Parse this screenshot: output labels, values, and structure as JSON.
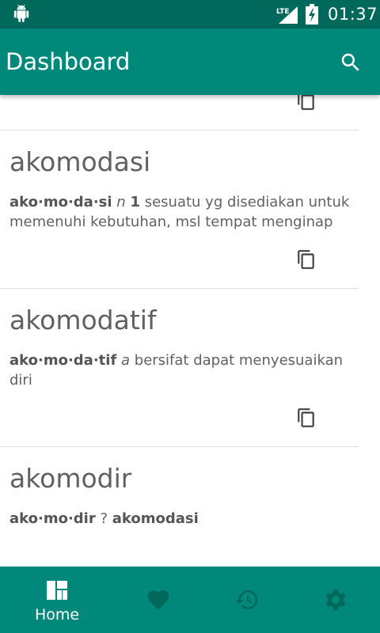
{
  "status_bar": {
    "time": "01:37",
    "network": "LTE"
  },
  "app_bar": {
    "title": "Dashboard",
    "search_icon": "search-icon"
  },
  "entries": [
    {
      "word": "",
      "syllables": "",
      "pos": "",
      "sense": "",
      "text": ""
    },
    {
      "word": "akomodasi",
      "syllables": "ako·mo·da·si",
      "pos": "n",
      "sense": "1",
      "text": "sesuatu yg disediakan untuk memenuhi kebutuhan, msl tempat menginap"
    },
    {
      "word": "akomodatif",
      "syllables": "ako·mo·da·tif",
      "pos": "a",
      "sense": "",
      "text": "bersifat dapat menyesuaikan diri"
    },
    {
      "word": "akomodir",
      "syllables": "ako·mo·dir",
      "pos": "",
      "sense": "",
      "text": "?",
      "ref": "akomodasi"
    }
  ],
  "bottom_nav": {
    "home_label": "Home",
    "items": [
      "dashboard-icon",
      "heart-icon",
      "history-icon",
      "gear-icon"
    ]
  },
  "colors": {
    "status_bar": "#00695c",
    "primary": "#00897b",
    "text_secondary": "#616161",
    "divider": "#dddddd"
  }
}
